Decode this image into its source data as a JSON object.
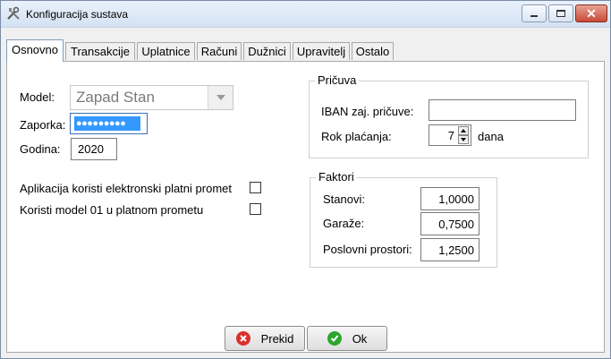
{
  "window": {
    "title": "Konfiguracija sustava",
    "icon": "tools-icon"
  },
  "tabs": [
    {
      "label": "Osnovno",
      "active": true
    },
    {
      "label": "Transakcije"
    },
    {
      "label": "Uplatnice"
    },
    {
      "label": "Računi"
    },
    {
      "label": "Dužnici"
    },
    {
      "label": "Upravitelj"
    },
    {
      "label": "Ostalo"
    }
  ],
  "form": {
    "model_label": "Model:",
    "model_value": "Zapad Stan",
    "password_label": "Zaporka:",
    "password_value": "●●●●●●●●●",
    "year_label": "Godina:",
    "year_value": "2020",
    "check_electronic_label": "Aplikacija koristi elektronski platni promet",
    "check_model01_label": "Koristi model 01 u platnom prometu"
  },
  "reserve": {
    "title": "Pričuva",
    "iban_label": "IBAN zaj. pričuve:",
    "iban_value": "",
    "due_label": "Rok plaćanja:",
    "due_value": "7",
    "due_unit": "dana"
  },
  "factors": {
    "title": "Faktori",
    "flats_label": "Stanovi:",
    "flats_value": "1,0000",
    "garages_label": "Garaže:",
    "garages_value": "0,7500",
    "business_label": "Poslovni prostori:",
    "business_value": "1,2500"
  },
  "buttons": {
    "cancel_label": "Prekid",
    "ok_label": "Ok"
  },
  "colors": {
    "selection": "#3399ff",
    "cancel_icon": "#d9302c",
    "ok_icon": "#2ea52e"
  }
}
